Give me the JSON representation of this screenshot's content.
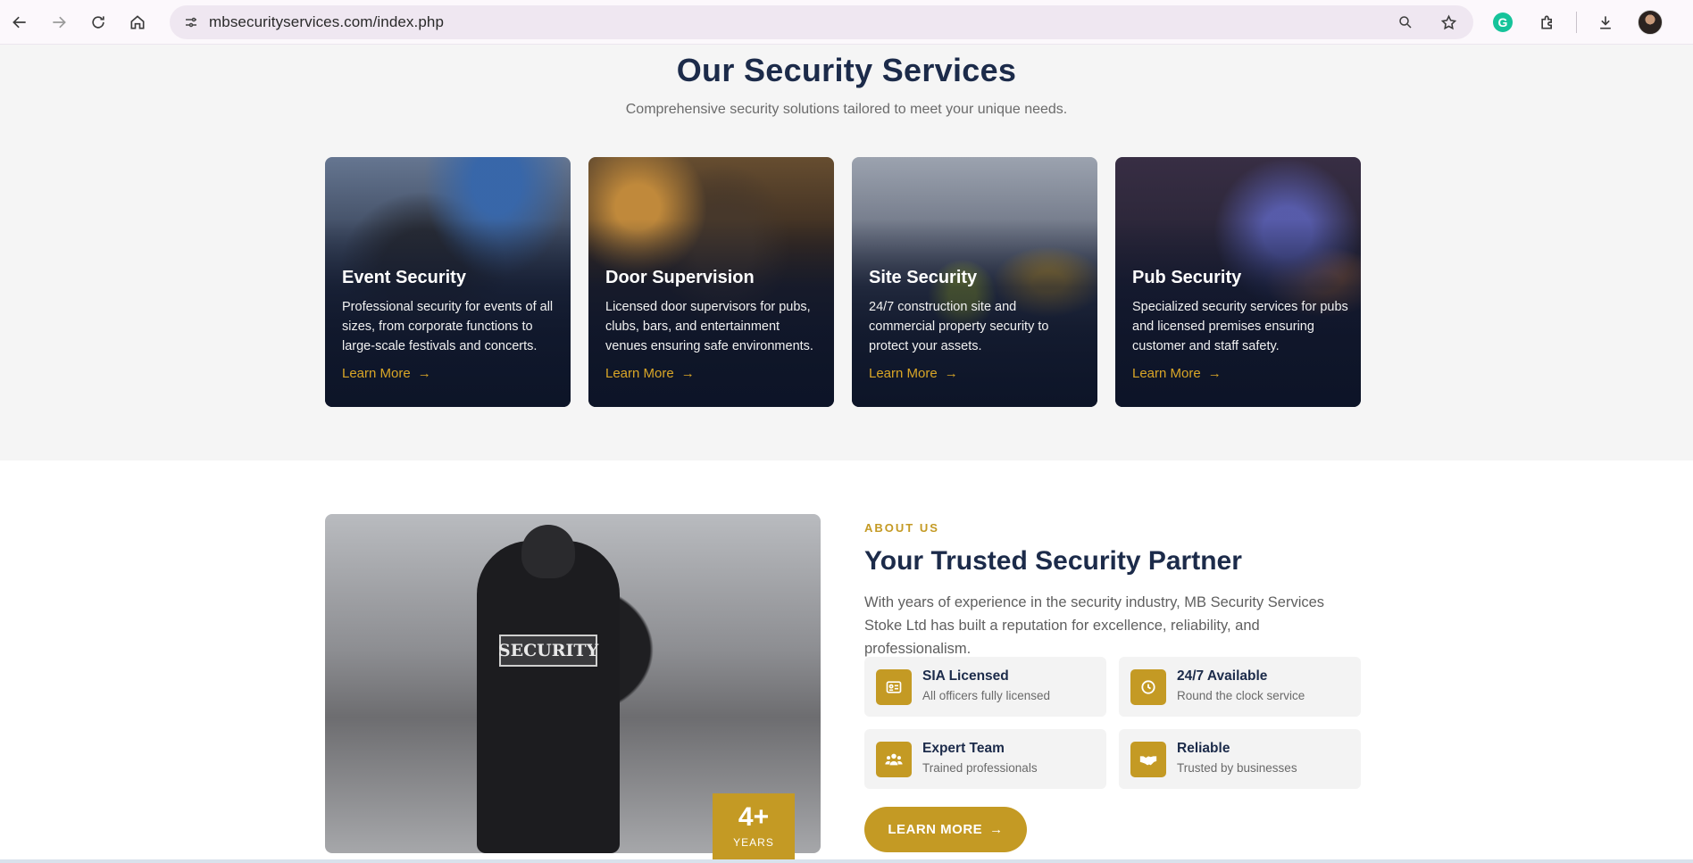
{
  "browser": {
    "url": "mbsecurityservices.com/index.php",
    "grammarly_letter": "G"
  },
  "services": {
    "title": "Our Security Services",
    "subtitle": "Comprehensive security solutions tailored to meet your unique needs.",
    "cards": [
      {
        "title": "Event Security",
        "text": "Professional security for events of all sizes, from corporate functions to large-scale festivals and concerts.",
        "link": "Learn More"
      },
      {
        "title": "Door Supervision",
        "text": "Licensed door supervisors for pubs, clubs, bars, and entertainment venues ensuring safe environments.",
        "link": "Learn More"
      },
      {
        "title": "Site Security",
        "text": "24/7 construction site and commercial property security to protect your assets.",
        "link": "Learn More"
      },
      {
        "title": "Pub Security",
        "text": "Specialized security services for pubs and licensed premises ensuring customer and staff safety.",
        "link": "Learn More"
      }
    ]
  },
  "about": {
    "photo_patch": "SECURITY",
    "badge_big": "4+",
    "badge_small": "YEARS",
    "eyebrow": "ABOUT US",
    "title": "Your Trusted Security Partner",
    "description": "With years of experience in the security industry, MB Security Services Stoke Ltd has built a reputation for excellence, reliability, and professionalism.",
    "features": [
      {
        "title": "SIA Licensed",
        "sub": "All officers fully licensed",
        "icon": "id-card-icon"
      },
      {
        "title": "24/7 Available",
        "sub": "Round the clock service",
        "icon": "clock-icon"
      },
      {
        "title": "Expert Team",
        "sub": "Trained professionals",
        "icon": "team-icon"
      },
      {
        "title": "Reliable",
        "sub": "Trusted by businesses",
        "icon": "handshake-icon"
      }
    ],
    "cta": "LEARN MORE"
  },
  "colors": {
    "accent": "#c49a24",
    "navy": "#1c2b4a"
  }
}
